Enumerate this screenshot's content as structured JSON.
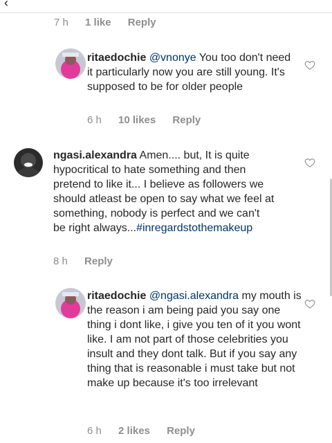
{
  "top_meta": {
    "time": "7 h",
    "likes": "1 like",
    "reply": "Reply"
  },
  "comments": [
    {
      "username": "ritaedochie",
      "mention": "@vnonye",
      "text": "You too don't need it particularly now you are still young. It's supposed to be for older people",
      "time": "6 h",
      "likes": "10 likes",
      "reply": "Reply"
    },
    {
      "username": "ngasi.alexandra",
      "text": "Amen.... but, It is quite hypocritical to hate something and then pretend to like it... I believe as followers we should atleast  be open to say what we feel at something, nobody is perfect and we can't be right always...",
      "hashtag": "#inregardstothemakeup",
      "time": "8 h",
      "reply": "Reply"
    },
    {
      "username": "ritaedochie",
      "mention": "@ngasi.alexandra",
      "text": "my mouth is the reason i am being paid you say one thing i dont like, i give you ten of it you wont like. I am not part of those celebrities you insult and they dont talk. But if you say any thing that is reasonable i must take but  not make up because it's too irrelevant",
      "time": "6 h",
      "likes": "2 likes",
      "reply": "Reply"
    }
  ],
  "icons": {
    "like": "heart-outline-icon"
  },
  "colors": {
    "link": "#003569",
    "meta": "#8e8e8e",
    "text": "#262626"
  }
}
